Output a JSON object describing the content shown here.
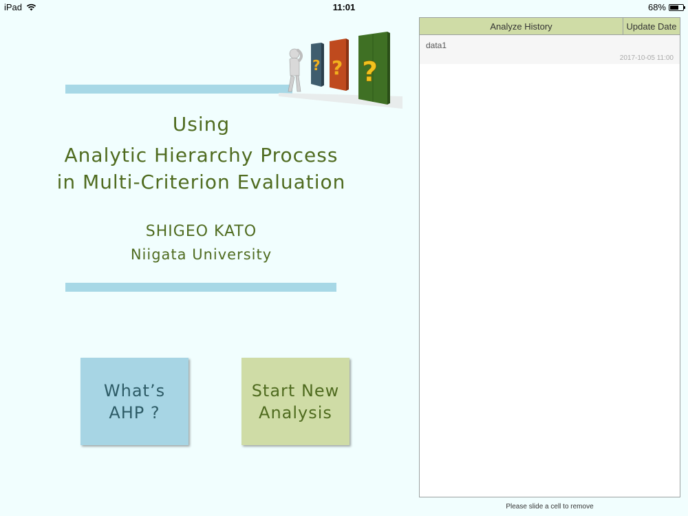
{
  "status_bar": {
    "device": "iPad",
    "time": "11:01",
    "battery": "68%",
    "battery_level": 0.68
  },
  "intro": {
    "title_line1": "Using",
    "title_line2": "Analytic Hierarchy Process",
    "title_line3": "in Multi-Criterion Evaluation",
    "author": "SHIGEO KATO",
    "university": "Niigata University"
  },
  "buttons": {
    "whats_ahp_line1": "What’s",
    "whats_ahp_line2": "AHP ?",
    "start_new_line1": "Start New",
    "start_new_line2": "Analysis"
  },
  "history": {
    "header_history": "Analyze History",
    "header_date": "Update Date",
    "rows": [
      {
        "name": "data1",
        "date": "2017-10-05 11:00"
      }
    ],
    "hint": "Please slide a cell to remove"
  },
  "colors": {
    "background": "#f1fefe",
    "accent_blue": "#a7d5e4",
    "accent_green": "#cfdca6",
    "text_green": "#4f6b1f"
  }
}
